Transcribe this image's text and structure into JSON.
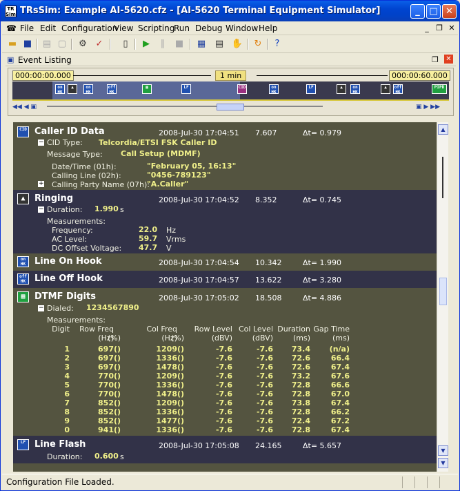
{
  "window": {
    "title": "TRsSim:  Example AI-5620.cfz - [AI-5620  Terminal Equipment Simulator]",
    "app_icon": "TR Sim"
  },
  "menu": [
    "File",
    "Edit",
    "Configuration",
    "View",
    "Scripting",
    "Run",
    "Debug",
    "Window",
    "Help"
  ],
  "pane": {
    "title": "Event Listing"
  },
  "timeline": {
    "start": "000:00:00.000",
    "span": "1 min",
    "end": "000:00:60.000"
  },
  "events": [
    {
      "title": "Caller ID Data",
      "date": "2008-Jul-30  17:04:51",
      "secs": "7.607",
      "dt": "Δt= 0.979",
      "icon": "CID"
    },
    {
      "title": "Ringing",
      "date": "2008-Jul-30  17:04:52",
      "secs": "8.352",
      "dt": "Δt= 0.745"
    },
    {
      "title": "Line On Hook",
      "date": "2008-Jul-30  17:04:54",
      "secs": "10.342",
      "dt": "Δt= 1.990",
      "icon": "on HK"
    },
    {
      "title": "Line Off Hook",
      "date": "2008-Jul-30  17:04:57",
      "secs": "13.622",
      "dt": "Δt= 3.280",
      "icon": "off HK"
    },
    {
      "title": "DTMF Digits",
      "date": "2008-Jul-30  17:05:02",
      "secs": "18.508",
      "dt": "Δt= 4.886"
    },
    {
      "title": "Line Flash",
      "date": "2008-Jul-30  17:05:08",
      "secs": "24.165",
      "dt": "Δt= 5.657"
    }
  ],
  "cid": {
    "type_label": "CID Type:",
    "type_value": "Telcordia/ETSI FSK Caller ID",
    "msg_label": "Message Type:",
    "msg_value": "Call Setup (MDMF)",
    "fields": [
      {
        "label": "Date/Time (01h):",
        "value": "\"February 05, 16:13\""
      },
      {
        "label": "Calling Line (02h):",
        "value": "\"0456-789123\""
      },
      {
        "label": "Calling Party Name (07h):",
        "value": "\"A.Caller\""
      }
    ]
  },
  "ringing": {
    "duration_label": "Duration:",
    "duration_value": "1.990",
    "duration_unit": "s",
    "meas_label": "Measurements:",
    "rows": [
      {
        "label": "Frequency:",
        "value": "22.0",
        "unit": "Hz"
      },
      {
        "label": "AC Level:",
        "value": "59.7",
        "unit": "Vrms"
      },
      {
        "label": "DC Offset Voltage:",
        "value": "47.7",
        "unit": "V"
      }
    ]
  },
  "dtmf": {
    "dialed_label": "Dialed:",
    "dialed_value": "1234567890",
    "meas_label": "Measurements:",
    "headers": [
      "Digit",
      "Row Freq",
      "",
      "Col Freq",
      "",
      "Row Level",
      "Col Level",
      "Duration",
      "Gap Time"
    ],
    "units": [
      "",
      "(Hz)",
      "(%)",
      "(Hz)",
      "(%)",
      "(dBV)",
      "(dBV)",
      "(ms)",
      "(ms)"
    ],
    "rows": [
      [
        "1",
        "697",
        "()",
        "1209",
        "()",
        "-7.6",
        "-7.6",
        "73.4",
        "(n/a)"
      ],
      [
        "2",
        "697",
        "()",
        "1336",
        "()",
        "-7.6",
        "-7.6",
        "72.6",
        "66.4"
      ],
      [
        "3",
        "697",
        "()",
        "1478",
        "()",
        "-7.6",
        "-7.6",
        "72.6",
        "67.4"
      ],
      [
        "4",
        "770",
        "()",
        "1209",
        "()",
        "-7.6",
        "-7.6",
        "73.2",
        "67.6"
      ],
      [
        "5",
        "770",
        "()",
        "1336",
        "()",
        "-7.6",
        "-7.6",
        "72.8",
        "66.6"
      ],
      [
        "6",
        "770",
        "()",
        "1478",
        "()",
        "-7.6",
        "-7.6",
        "72.8",
        "67.0"
      ],
      [
        "7",
        "852",
        "()",
        "1209",
        "()",
        "-7.6",
        "-7.6",
        "73.8",
        "67.4"
      ],
      [
        "8",
        "852",
        "()",
        "1336",
        "()",
        "-7.6",
        "-7.6",
        "72.8",
        "66.2"
      ],
      [
        "9",
        "852",
        "()",
        "1477",
        "()",
        "-7.6",
        "-7.6",
        "72.4",
        "67.2"
      ],
      [
        "0",
        "941",
        "()",
        "1336",
        "()",
        "-7.6",
        "-7.6",
        "72.8",
        "67.4"
      ]
    ]
  },
  "flash": {
    "duration_label": "Duration:",
    "duration_value": "0.600",
    "duration_unit": "s"
  },
  "status": {
    "text": "Configuration File Loaded."
  }
}
